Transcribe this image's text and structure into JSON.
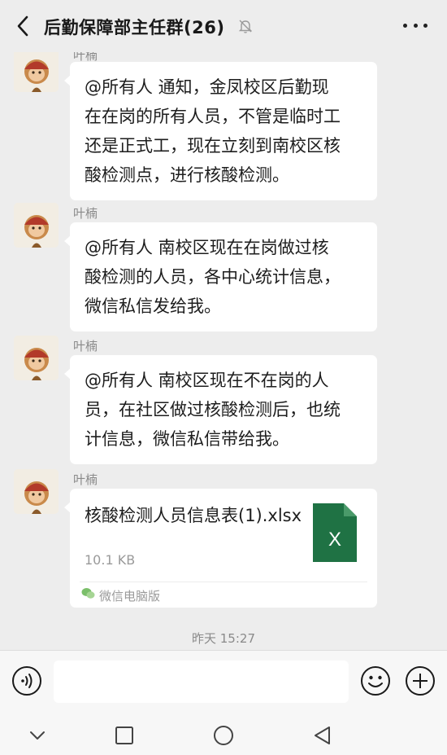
{
  "header": {
    "back_icon": "chevron-left-icon",
    "title": "后勤保障部主任群(26)",
    "mute_icon": "bell-off-icon",
    "more_icon": "more-dots-icon"
  },
  "messages": [
    {
      "sender": "叶楠",
      "text_lines": [
        "@所有人  通知，金凤校区后勤现",
        "在在岗的所有人员，不管是临时工",
        "还是正式工，现在立刻到南校区核",
        "酸检测点，进行核酸检测。"
      ]
    },
    {
      "sender": "叶楠",
      "text_lines": [
        "@所有人  南校区现在在岗做过核",
        "酸检测的人员，各中心统计信息，",
        "微信私信发给我。"
      ]
    },
    {
      "sender": "叶楠",
      "text_lines": [
        "@所有人  南校区现在不在岗的人",
        "员，在社区做过核酸检测后，也统",
        "计信息，微信私信带给我。"
      ]
    },
    {
      "sender": "叶楠",
      "file": {
        "name": "核酸检测人员信息表(1).xlsx",
        "size": "10.1 KB",
        "icon_letter": "X",
        "icon_color": "#1f7244",
        "source": "微信电脑版"
      }
    }
  ],
  "timestamp": "昨天 15:27",
  "input_bar": {
    "voice_icon": "voice-icon",
    "input_value": "",
    "emoji_icon": "emoji-icon",
    "plus_icon": "plus-circle-icon"
  },
  "nav_bar": {
    "icons": [
      "chevron-down-icon",
      "square-icon",
      "circle-icon",
      "triangle-back-icon"
    ]
  },
  "colors": {
    "background": "#ededed",
    "bubble": "#ffffff",
    "excel_green": "#1f7244"
  }
}
